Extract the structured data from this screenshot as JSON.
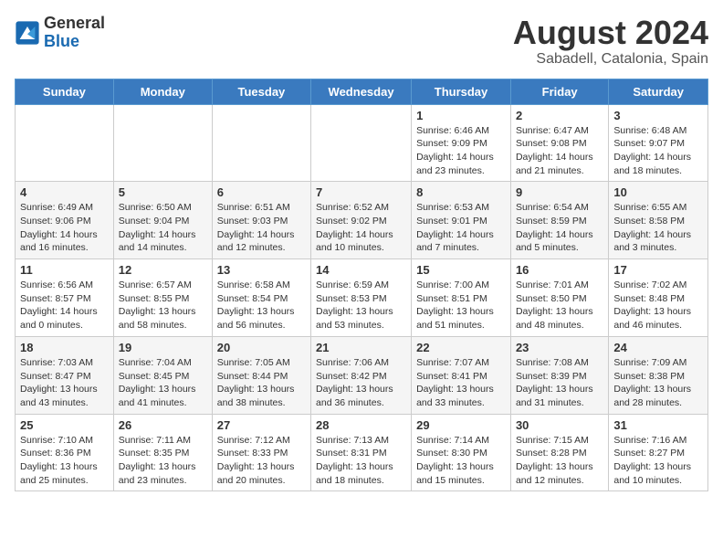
{
  "header": {
    "logo_general": "General",
    "logo_blue": "Blue",
    "month_year": "August 2024",
    "location": "Sabadell, Catalonia, Spain"
  },
  "weekdays": [
    "Sunday",
    "Monday",
    "Tuesday",
    "Wednesday",
    "Thursday",
    "Friday",
    "Saturday"
  ],
  "weeks": [
    [
      {
        "day": "",
        "info": ""
      },
      {
        "day": "",
        "info": ""
      },
      {
        "day": "",
        "info": ""
      },
      {
        "day": "",
        "info": ""
      },
      {
        "day": "1",
        "info": "Sunrise: 6:46 AM\nSunset: 9:09 PM\nDaylight: 14 hours and 23 minutes."
      },
      {
        "day": "2",
        "info": "Sunrise: 6:47 AM\nSunset: 9:08 PM\nDaylight: 14 hours and 21 minutes."
      },
      {
        "day": "3",
        "info": "Sunrise: 6:48 AM\nSunset: 9:07 PM\nDaylight: 14 hours and 18 minutes."
      }
    ],
    [
      {
        "day": "4",
        "info": "Sunrise: 6:49 AM\nSunset: 9:06 PM\nDaylight: 14 hours and 16 minutes."
      },
      {
        "day": "5",
        "info": "Sunrise: 6:50 AM\nSunset: 9:04 PM\nDaylight: 14 hours and 14 minutes."
      },
      {
        "day": "6",
        "info": "Sunrise: 6:51 AM\nSunset: 9:03 PM\nDaylight: 14 hours and 12 minutes."
      },
      {
        "day": "7",
        "info": "Sunrise: 6:52 AM\nSunset: 9:02 PM\nDaylight: 14 hours and 10 minutes."
      },
      {
        "day": "8",
        "info": "Sunrise: 6:53 AM\nSunset: 9:01 PM\nDaylight: 14 hours and 7 minutes."
      },
      {
        "day": "9",
        "info": "Sunrise: 6:54 AM\nSunset: 8:59 PM\nDaylight: 14 hours and 5 minutes."
      },
      {
        "day": "10",
        "info": "Sunrise: 6:55 AM\nSunset: 8:58 PM\nDaylight: 14 hours and 3 minutes."
      }
    ],
    [
      {
        "day": "11",
        "info": "Sunrise: 6:56 AM\nSunset: 8:57 PM\nDaylight: 14 hours and 0 minutes."
      },
      {
        "day": "12",
        "info": "Sunrise: 6:57 AM\nSunset: 8:55 PM\nDaylight: 13 hours and 58 minutes."
      },
      {
        "day": "13",
        "info": "Sunrise: 6:58 AM\nSunset: 8:54 PM\nDaylight: 13 hours and 56 minutes."
      },
      {
        "day": "14",
        "info": "Sunrise: 6:59 AM\nSunset: 8:53 PM\nDaylight: 13 hours and 53 minutes."
      },
      {
        "day": "15",
        "info": "Sunrise: 7:00 AM\nSunset: 8:51 PM\nDaylight: 13 hours and 51 minutes."
      },
      {
        "day": "16",
        "info": "Sunrise: 7:01 AM\nSunset: 8:50 PM\nDaylight: 13 hours and 48 minutes."
      },
      {
        "day": "17",
        "info": "Sunrise: 7:02 AM\nSunset: 8:48 PM\nDaylight: 13 hours and 46 minutes."
      }
    ],
    [
      {
        "day": "18",
        "info": "Sunrise: 7:03 AM\nSunset: 8:47 PM\nDaylight: 13 hours and 43 minutes."
      },
      {
        "day": "19",
        "info": "Sunrise: 7:04 AM\nSunset: 8:45 PM\nDaylight: 13 hours and 41 minutes."
      },
      {
        "day": "20",
        "info": "Sunrise: 7:05 AM\nSunset: 8:44 PM\nDaylight: 13 hours and 38 minutes."
      },
      {
        "day": "21",
        "info": "Sunrise: 7:06 AM\nSunset: 8:42 PM\nDaylight: 13 hours and 36 minutes."
      },
      {
        "day": "22",
        "info": "Sunrise: 7:07 AM\nSunset: 8:41 PM\nDaylight: 13 hours and 33 minutes."
      },
      {
        "day": "23",
        "info": "Sunrise: 7:08 AM\nSunset: 8:39 PM\nDaylight: 13 hours and 31 minutes."
      },
      {
        "day": "24",
        "info": "Sunrise: 7:09 AM\nSunset: 8:38 PM\nDaylight: 13 hours and 28 minutes."
      }
    ],
    [
      {
        "day": "25",
        "info": "Sunrise: 7:10 AM\nSunset: 8:36 PM\nDaylight: 13 hours and 25 minutes."
      },
      {
        "day": "26",
        "info": "Sunrise: 7:11 AM\nSunset: 8:35 PM\nDaylight: 13 hours and 23 minutes."
      },
      {
        "day": "27",
        "info": "Sunrise: 7:12 AM\nSunset: 8:33 PM\nDaylight: 13 hours and 20 minutes."
      },
      {
        "day": "28",
        "info": "Sunrise: 7:13 AM\nSunset: 8:31 PM\nDaylight: 13 hours and 18 minutes."
      },
      {
        "day": "29",
        "info": "Sunrise: 7:14 AM\nSunset: 8:30 PM\nDaylight: 13 hours and 15 minutes."
      },
      {
        "day": "30",
        "info": "Sunrise: 7:15 AM\nSunset: 8:28 PM\nDaylight: 13 hours and 12 minutes."
      },
      {
        "day": "31",
        "info": "Sunrise: 7:16 AM\nSunset: 8:27 PM\nDaylight: 13 hours and 10 minutes."
      }
    ]
  ]
}
